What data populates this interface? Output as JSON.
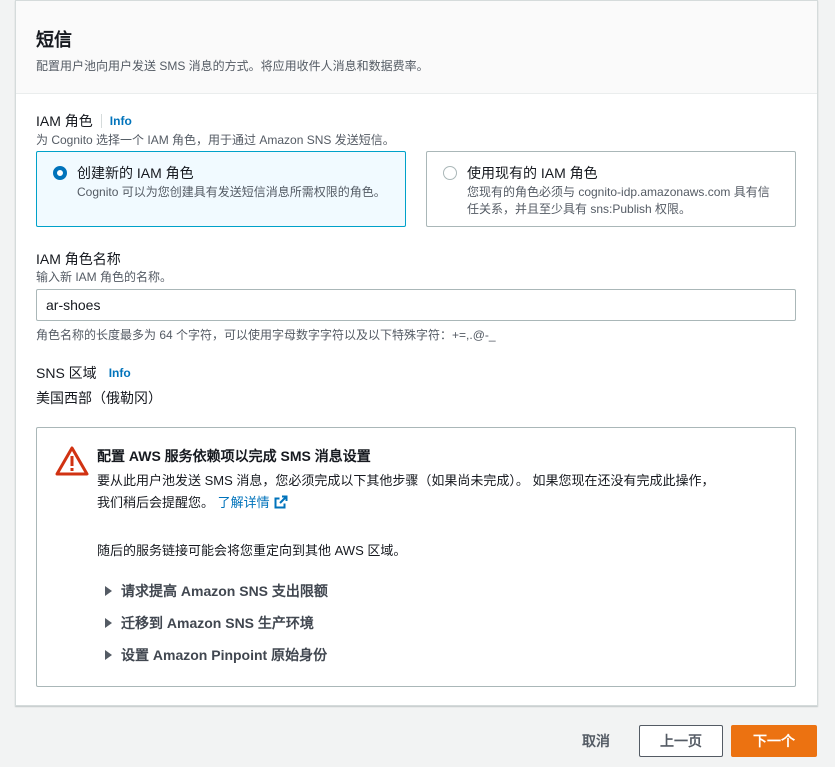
{
  "section": {
    "title": "短信",
    "description": "配置用户池向用户发送 SMS 消息的方式。将应用收件人消息和数据费率。"
  },
  "iam_role": {
    "label": "IAM 角色",
    "info": "Info",
    "description": "为 Cognito 选择一个 IAM 角色，用于通过 Amazon SNS 发送短信。",
    "options": [
      {
        "title": "创建新的 IAM 角色",
        "description": "Cognito 可以为您创建具有发送短信消息所需权限的角色。",
        "selected": true
      },
      {
        "title": "使用现有的 IAM 角色",
        "description_line1": "您现有的角色必须与 cognito-idp.amazonaws.com 具有信",
        "description_line2": "任关系，并且至少具有 sns:Publish 权限。",
        "selected": false
      }
    ]
  },
  "role_name": {
    "label": "IAM 角色名称",
    "description": "输入新 IAM 角色的名称。",
    "value": "ar-shoes",
    "constraint": "角色名称的长度最多为 64 个字符，可以使用字母数字字符以及以下特殊字符：+=,.@-_"
  },
  "sns_region": {
    "label": "SNS 区域",
    "info": "Info",
    "value": "美国西部（俄勒冈）"
  },
  "alert": {
    "icon": "warning-triangle-icon",
    "title": "配置 AWS 服务依赖项以完成 SMS 消息设置",
    "text_line1": "要从此用户池发送 SMS 消息，您必须完成以下其他步骤（如果尚未完成）。 如果您现在还没有完成此操作，",
    "text_line2": "我们稍后会提醒您。",
    "learn_more": "了解详情",
    "text_redirect": "随后的服务链接可能会将您重定向到其他 AWS 区域。",
    "expandables": [
      "请求提高 Amazon SNS 支出限额",
      "迁移到 Amazon SNS 生产环境",
      "设置 Amazon Pinpoint 原始身份"
    ]
  },
  "footer": {
    "cancel": "取消",
    "previous": "上一页",
    "next": "下一个"
  },
  "colors": {
    "accent": "#0073bb",
    "primary_button": "#ec7211",
    "warning": "#d13212"
  }
}
